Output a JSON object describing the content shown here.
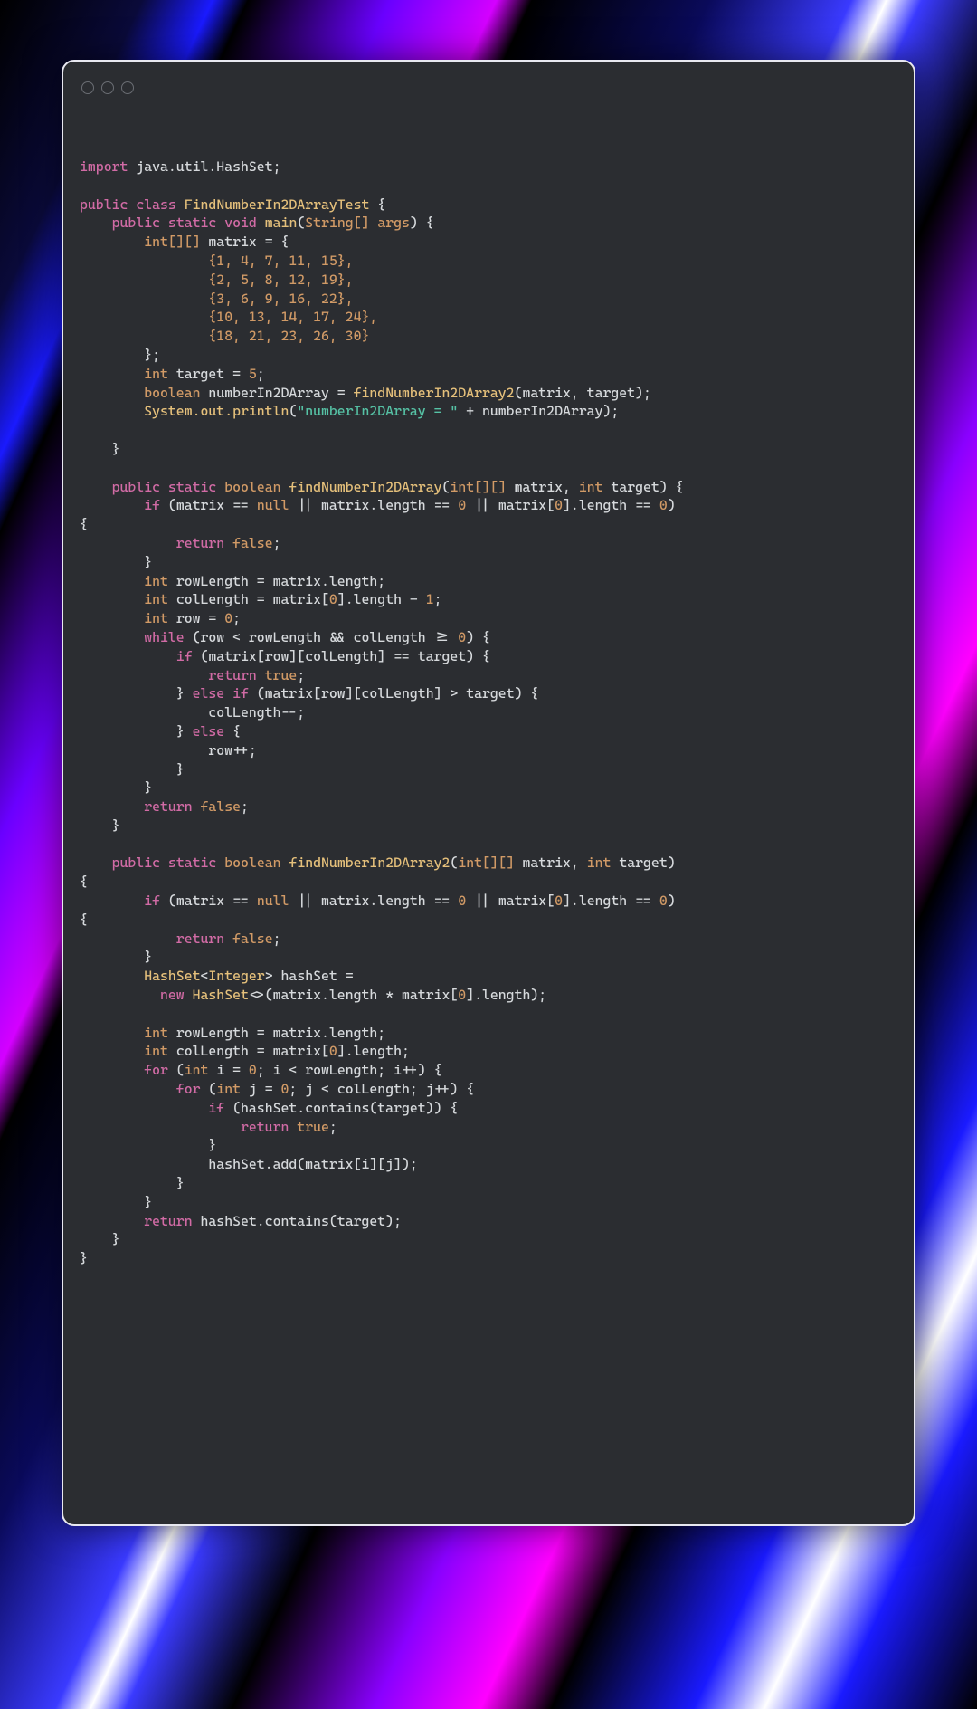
{
  "window": {
    "traffic_dots": 3
  },
  "code": {
    "import_kw": "import",
    "import_pkg": " java.util.HashSet;",
    "public": "public",
    "class": "class",
    "class_name": "FindNumberIn2DArrayTest",
    "static": "static",
    "void": "void",
    "main": "main",
    "string_arr": "String[] args",
    "int_arr2": "int[][]",
    "matrix": "matrix",
    "row1": "{1, 4, 7, 11, 15},",
    "row2": "{2, 5, 8, 12, 19},",
    "row3": "{3, 6, 9, 16, 22},",
    "row4": "{10, 13, 14, 17, 24},",
    "row5": "{18, 21, 23, 26, 30}",
    "int": "int",
    "target": "target",
    "five": "5",
    "boolean": "boolean",
    "numberIn2DArray": "numberIn2DArray",
    "findNumberIn2DArray2": "findNumberIn2DArray2",
    "system_out_println": "System.out.println",
    "str_lit": "\"numberIn2DArray = \"",
    "findNumberIn2DArray": "findNumberIn2DArray",
    "if": "if",
    "null": "null",
    "length": "length",
    "zero": "0",
    "return": "return",
    "false": "false",
    "true": "true",
    "rowLength": "rowLength",
    "colLength": "colLength",
    "row": "row",
    "while": "while",
    "else": "else",
    "HashSet": "HashSet",
    "Integer": "Integer",
    "hashSet": "hashSet",
    "new": "new",
    "for": "for",
    "i": "i",
    "j": "j",
    "contains": "contains",
    "add": "add",
    "one": "1"
  }
}
